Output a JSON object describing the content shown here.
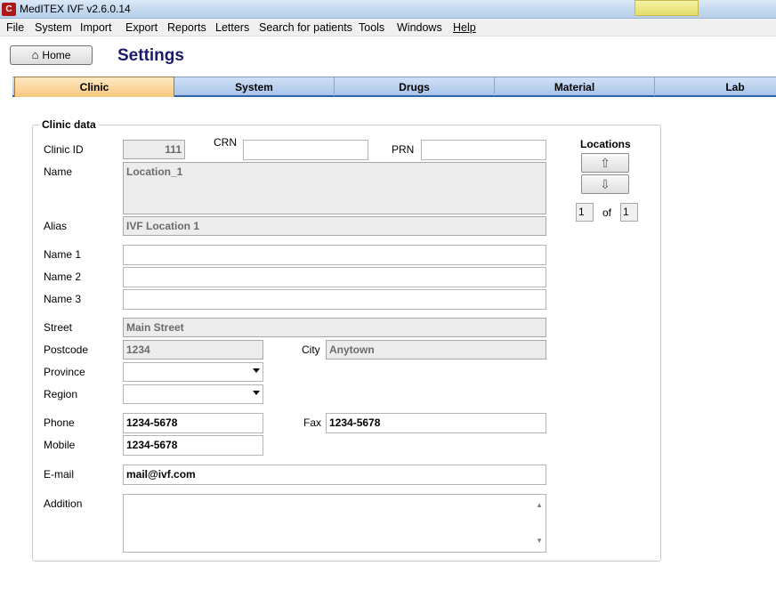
{
  "window": {
    "title": "MedITEX IVF v2.6.0.14",
    "icon": "app-logo-icon",
    "app_icon_text": "C"
  },
  "menu": [
    "File",
    "System",
    "Import",
    "Export",
    "Reports",
    "Letters",
    "Search for patients",
    "Tools",
    "Windows",
    "Help"
  ],
  "header": {
    "home_label": "Home",
    "page_title": "Settings"
  },
  "tabs": [
    {
      "label": "Clinic",
      "active": true
    },
    {
      "label": "System"
    },
    {
      "label": "Drugs"
    },
    {
      "label": "Material"
    },
    {
      "label": "Lab"
    }
  ],
  "clinic": {
    "group_title": "Clinic data",
    "labels": {
      "clinic_id": "Clinic ID",
      "crn": "CRN",
      "prn": "PRN",
      "name": "Name",
      "alias": "Alias",
      "name1": "Name 1",
      "name2": "Name 2",
      "name3": "Name 3",
      "street": "Street",
      "postcode": "Postcode",
      "city": "City",
      "province": "Province",
      "region": "Region",
      "phone": "Phone",
      "fax": "Fax",
      "mobile": "Mobile",
      "email": "E-mail",
      "addition": "Addition"
    },
    "values": {
      "clinic_id": "111",
      "crn": "",
      "prn": "",
      "name": "Location_1",
      "alias": "IVF Location 1",
      "name1": "",
      "name2": "",
      "name3": "",
      "street": "Main Street",
      "postcode": "1234",
      "city": "Anytown",
      "province": "",
      "region": "",
      "phone": "1234-5678",
      "fax": "1234-5678",
      "mobile": "1234-5678",
      "email": "mail@ivf.com",
      "addition": ""
    }
  },
  "locations": {
    "title": "Locations",
    "up_glyph": "⇧",
    "down_glyph": "⇩",
    "current": "1",
    "of_label": "of",
    "total": "1"
  }
}
